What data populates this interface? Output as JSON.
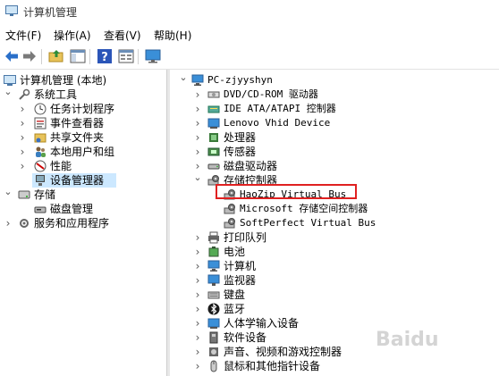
{
  "window": {
    "title": "计算机管理"
  },
  "menu": [
    "文件(F)",
    "操作(A)",
    "查看(V)",
    "帮助(H)"
  ],
  "toolbar": [
    "back-icon",
    "forward-icon",
    "up-folder-icon",
    "show-hide-tree-icon",
    "help-icon",
    "properties-icon",
    "monitor-icon"
  ],
  "left_tree": [
    {
      "label": "计算机管理 (本地)",
      "expander": "",
      "icon": "computer-management-icon"
    },
    {
      "label": "系统工具",
      "expander": "expanded",
      "icon": "tools-icon"
    },
    {
      "label": "任务计划程序",
      "expander": "collapsed",
      "icon": "task-scheduler-icon"
    },
    {
      "label": "事件查看器",
      "expander": "collapsed",
      "icon": "event-viewer-icon"
    },
    {
      "label": "共享文件夹",
      "expander": "collapsed",
      "icon": "shared-folder-icon"
    },
    {
      "label": "本地用户和组",
      "expander": "collapsed",
      "icon": "users-icon"
    },
    {
      "label": "性能",
      "expander": "collapsed",
      "icon": "performance-icon"
    },
    {
      "label": "设备管理器",
      "expander": "",
      "icon": "device-manager-icon",
      "selected": true
    },
    {
      "label": "存储",
      "expander": "expanded",
      "icon": "storage-icon"
    },
    {
      "label": "磁盘管理",
      "expander": "",
      "icon": "disk-management-icon"
    },
    {
      "label": "服务和应用程序",
      "expander": "collapsed",
      "icon": "services-icon"
    }
  ],
  "device_tree": [
    {
      "label": "PC-zjyyshyn",
      "expander": "expanded",
      "icon": "computer-icon"
    },
    {
      "label": "DVD/CD-ROM 驱动器",
      "expander": "collapsed",
      "icon": "dvd-icon"
    },
    {
      "label": "IDE ATA/ATAPI 控制器",
      "expander": "collapsed",
      "icon": "ide-icon"
    },
    {
      "label": "Lenovo Vhid Device",
      "expander": "collapsed",
      "icon": "hid-icon"
    },
    {
      "label": "处理器",
      "expander": "collapsed",
      "icon": "processor-icon"
    },
    {
      "label": "传感器",
      "expander": "collapsed",
      "icon": "sensor-icon"
    },
    {
      "label": "磁盘驱动器",
      "expander": "collapsed",
      "icon": "disk-drive-icon"
    },
    {
      "label": "存储控制器",
      "expander": "expanded",
      "icon": "storage-controller-icon"
    },
    {
      "label": "HaoZip Virtual Bus",
      "expander": "",
      "icon": "storage-controller-icon",
      "child": true
    },
    {
      "label": "Microsoft 存储空间控制器",
      "expander": "",
      "icon": "storage-controller-icon",
      "child": true
    },
    {
      "label": "SoftPerfect Virtual Bus",
      "expander": "",
      "icon": "storage-controller-icon",
      "child": true
    },
    {
      "label": "打印队列",
      "expander": "collapsed",
      "icon": "printer-icon"
    },
    {
      "label": "电池",
      "expander": "collapsed",
      "icon": "battery-icon"
    },
    {
      "label": "计算机",
      "expander": "collapsed",
      "icon": "computer-icon"
    },
    {
      "label": "监视器",
      "expander": "collapsed",
      "icon": "monitor-icon"
    },
    {
      "label": "键盘",
      "expander": "collapsed",
      "icon": "keyboard-icon"
    },
    {
      "label": "蓝牙",
      "expander": "collapsed",
      "icon": "bluetooth-icon"
    },
    {
      "label": "人体学输入设备",
      "expander": "collapsed",
      "icon": "hid-icon"
    },
    {
      "label": "软件设备",
      "expander": "collapsed",
      "icon": "software-device-icon"
    },
    {
      "label": "声音、视频和游戏控制器",
      "expander": "collapsed",
      "icon": "sound-icon"
    },
    {
      "label": "鼠标和其他指针设备",
      "expander": "collapsed",
      "icon": "mouse-icon"
    }
  ],
  "colors": {
    "selection": "#cce8ff",
    "highlight_box": "#e02020"
  }
}
